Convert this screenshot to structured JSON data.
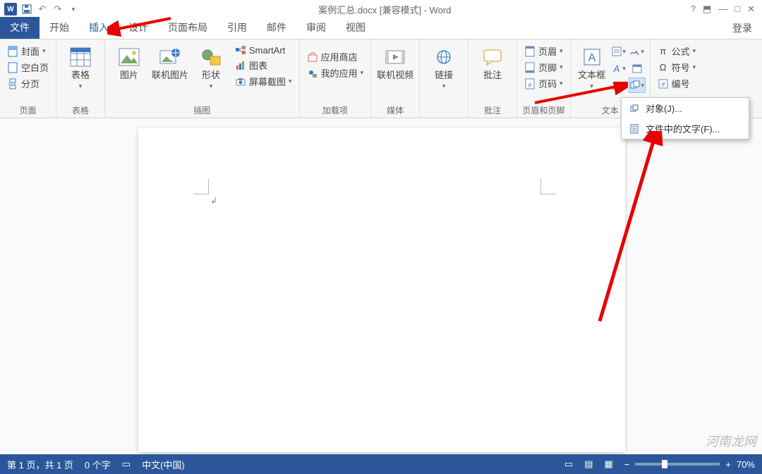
{
  "title": "案例汇总.docx [兼容模式] - Word",
  "window_buttons": {
    "help": "?",
    "ribbon_opts": "⬒",
    "min": "—",
    "restore": "□",
    "close": "✕"
  },
  "login": "登录",
  "tabs": {
    "file": "文件",
    "home": "开始",
    "insert": "插入",
    "design": "设计",
    "layout": "页面布局",
    "references": "引用",
    "mail": "邮件",
    "review": "审阅",
    "view": "视图"
  },
  "ribbon": {
    "pages": {
      "cover": "封面",
      "blank": "空白页",
      "break": "分页",
      "label": "页面"
    },
    "tables": {
      "table": "表格",
      "label": "表格"
    },
    "illustrations": {
      "picture": "图片",
      "online_picture": "联机图片",
      "shapes": "形状",
      "smartart": "SmartArt",
      "chart": "图表",
      "screenshot": "屏幕截图",
      "label": "插图"
    },
    "addins": {
      "store": "应用商店",
      "myapps": "我的应用",
      "label": "加载项"
    },
    "media": {
      "online_video": "联机视频",
      "label": "媒体"
    },
    "links": {
      "link": "链接",
      "label": ""
    },
    "comments": {
      "comment": "批注",
      "label": "批注"
    },
    "headerfooter": {
      "header": "页眉",
      "footer": "页脚",
      "pagenum": "页码",
      "label": "页眉和页脚"
    },
    "text": {
      "textbox": "文本框",
      "label": "文本"
    },
    "symbols": {
      "equation": "公式",
      "symbol": "符号",
      "number": "编号",
      "label": ""
    },
    "object_menu": {
      "object": "对象(J)...",
      "textfromfile": "文件中的文字(F)..."
    }
  },
  "statusbar": {
    "page": "第 1 页，共 1 页",
    "words": "0 个字",
    "lang": "中文(中国)",
    "zoom": "70%"
  },
  "watermark": "河南龙网"
}
